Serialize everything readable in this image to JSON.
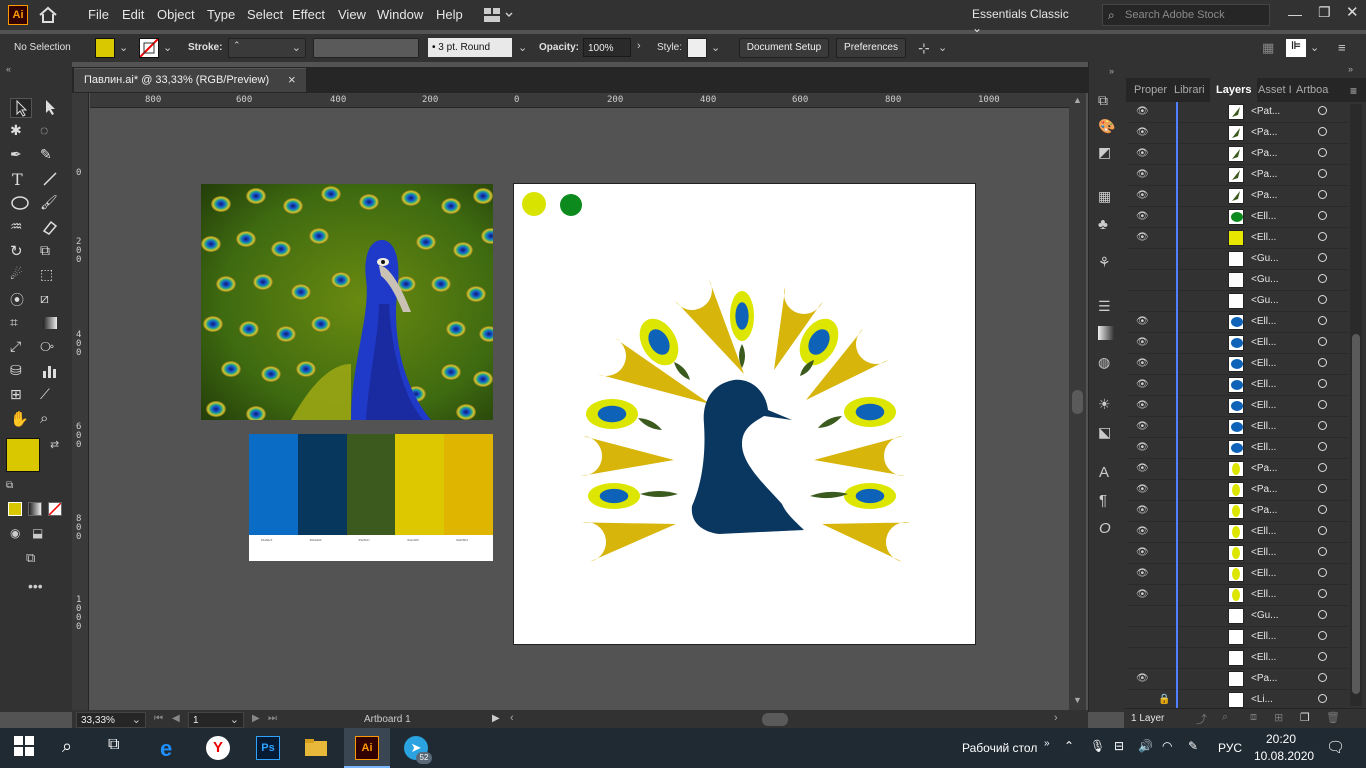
{
  "app": {
    "logo": "Ai",
    "workspace": "Essentials Classic",
    "search_placeholder": "Search Adobe Stock"
  },
  "menu": [
    "File",
    "Edit",
    "Object",
    "Type",
    "Select",
    "Effect",
    "View",
    "Window",
    "Help"
  ],
  "control": {
    "selection": "No Selection",
    "stroke_label": "Stroke:",
    "brush": "3 pt. Round",
    "opacity_label": "Opacity:",
    "opacity": "100%",
    "style_label": "Style:",
    "document_setup": "Document Setup",
    "preferences": "Preferences",
    "fill_color": "#d9c700"
  },
  "document": {
    "tab_title": "Павлин.ai* @ 33,33% (RGB/Preview)",
    "close": "×"
  },
  "ruler": {
    "h": [
      "800",
      "600",
      "400",
      "200",
      "0",
      "200",
      "400",
      "600",
      "800",
      "1000"
    ],
    "v": [
      "0",
      "2\n0\n0",
      "4\n0\n0",
      "6\n0\n0",
      "8\n0\n0",
      "1\n0\n0\n0"
    ]
  },
  "palette": {
    "colors": [
      "#0a6cc4",
      "#08375e",
      "#3c5a1e",
      "#ddc800",
      "#dfb500"
    ],
    "codes": [
      "#1a6bc1",
      "#0b3a63",
      "#3e5b1f",
      "#dccb05",
      "#e0b603"
    ]
  },
  "artboard": {
    "swatch_yellow": "#d9e300",
    "swatch_green": "#0c8a1e",
    "feather_gold": "#d8b50a",
    "feather_eye_ring": "#dde600",
    "feather_eye": "#0e63b8",
    "body": "#0a3760",
    "leaf": "#3b5a1d"
  },
  "status": {
    "zoom": "33,33%",
    "page": "1",
    "artboard_label": "Artboard 1"
  },
  "panels": {
    "tabs": [
      "Proper",
      "Librari",
      "Layers",
      "Asset I",
      "Artboa"
    ],
    "active": "Layers",
    "layer_count": "1 Layer"
  },
  "layers": [
    {
      "name": "<Pat...",
      "eye": true,
      "thumb": "leaf"
    },
    {
      "name": "<Pa...",
      "eye": true,
      "thumb": "leaf"
    },
    {
      "name": "<Pa...",
      "eye": true,
      "thumb": "leaf"
    },
    {
      "name": "<Pa...",
      "eye": true,
      "thumb": "leaf"
    },
    {
      "name": "<Pa...",
      "eye": true,
      "thumb": "leaf"
    },
    {
      "name": "<Ell...",
      "eye": true,
      "thumb": "green"
    },
    {
      "name": "<Ell...",
      "eye": true,
      "thumb": "yellow"
    },
    {
      "name": "<Gu...",
      "eye": false,
      "thumb": "white"
    },
    {
      "name": "<Gu...",
      "eye": false,
      "thumb": "white"
    },
    {
      "name": "<Gu...",
      "eye": false,
      "thumb": "white"
    },
    {
      "name": "<Ell...",
      "eye": true,
      "thumb": "blue"
    },
    {
      "name": "<Ell...",
      "eye": true,
      "thumb": "blue"
    },
    {
      "name": "<Ell...",
      "eye": true,
      "thumb": "blue"
    },
    {
      "name": "<Ell...",
      "eye": true,
      "thumb": "blue"
    },
    {
      "name": "<Ell...",
      "eye": true,
      "thumb": "blue"
    },
    {
      "name": "<Ell...",
      "eye": true,
      "thumb": "blue"
    },
    {
      "name": "<Ell...",
      "eye": true,
      "thumb": "blue"
    },
    {
      "name": "<Pa...",
      "eye": true,
      "thumb": "lime"
    },
    {
      "name": "<Pa...",
      "eye": true,
      "thumb": "lime"
    },
    {
      "name": "<Pa...",
      "eye": true,
      "thumb": "lime"
    },
    {
      "name": "<Ell...",
      "eye": true,
      "thumb": "lime"
    },
    {
      "name": "<Ell...",
      "eye": true,
      "thumb": "lime"
    },
    {
      "name": "<Ell...",
      "eye": true,
      "thumb": "lime"
    },
    {
      "name": "<Ell...",
      "eye": true,
      "thumb": "lime"
    },
    {
      "name": "<Gu...",
      "eye": false,
      "thumb": "white"
    },
    {
      "name": "<Ell...",
      "eye": false,
      "thumb": "white"
    },
    {
      "name": "<Ell...",
      "eye": false,
      "thumb": "white"
    },
    {
      "name": "<Pa...",
      "eye": true,
      "thumb": "white"
    },
    {
      "name": "<Li...",
      "eye": false,
      "thumb": "white",
      "locked": true
    }
  ],
  "taskbar": {
    "desktop": "Рабочий стол",
    "lang": "РУС",
    "time": "20:20",
    "date": "10.08.2020",
    "badge": "52"
  }
}
